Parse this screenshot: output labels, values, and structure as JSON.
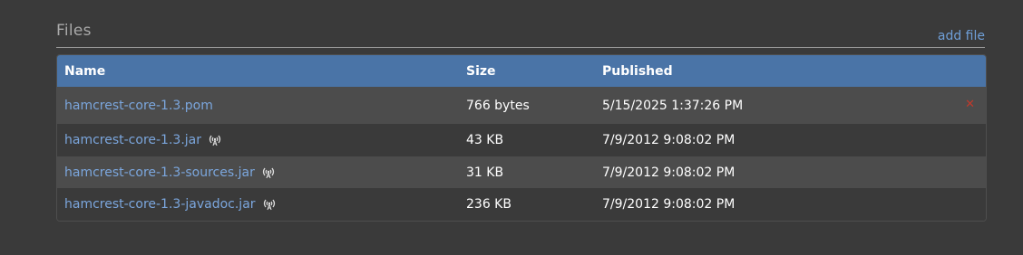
{
  "section": {
    "title": "Files",
    "add_file": "add file"
  },
  "table": {
    "headers": {
      "name": "Name",
      "size": "Size",
      "published": "Published"
    },
    "rows": [
      {
        "name": "hamcrest-core-1.3.pom",
        "size": "766 bytes",
        "published": "5/15/2025 1:37:26 PM",
        "signed": false,
        "deletable": true
      },
      {
        "name": "hamcrest-core-1.3.jar",
        "size": "43 KB",
        "published": "7/9/2012 9:08:02 PM",
        "signed": true,
        "deletable": false
      },
      {
        "name": "hamcrest-core-1.3-sources.jar",
        "size": "31 KB",
        "published": "7/9/2012 9:08:02 PM",
        "signed": true,
        "deletable": false
      },
      {
        "name": "hamcrest-core-1.3-javadoc.jar",
        "size": "236 KB",
        "published": "7/9/2012 9:08:02 PM",
        "signed": true,
        "deletable": false
      }
    ]
  },
  "icons": {
    "signature": "signature-antenna-icon",
    "delete": "delete-x-icon"
  },
  "colors": {
    "background": "#3a3a3a",
    "header_bg": "#4a74a7",
    "link": "#7ba6dd",
    "delete": "#c0392b"
  }
}
